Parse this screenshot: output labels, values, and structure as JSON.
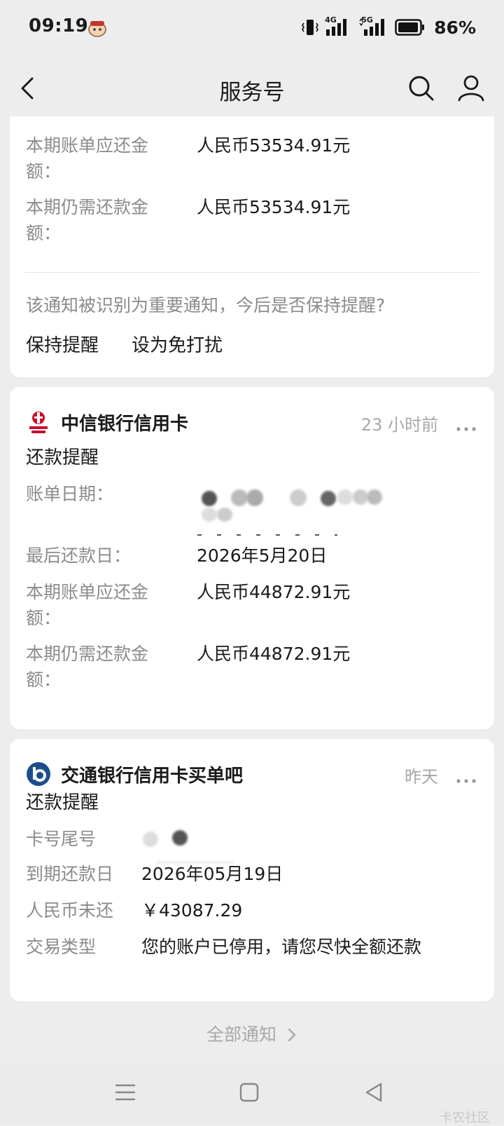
{
  "status_bar": {
    "time": "09:19",
    "network_1": "4G",
    "network_2": "5G",
    "battery": "86%",
    "icons": [
      "app-avatar-icon",
      "vibrate-icon",
      "signal-4g-icon",
      "signal-5g-icon",
      "battery-icon"
    ]
  },
  "header": {
    "title": "服务号",
    "icons": [
      "back-icon",
      "search-icon",
      "user-icon"
    ]
  },
  "card1": {
    "rows": [
      {
        "label_1": "本期账单应还金",
        "label_2": "额：",
        "value": "人民币53534.91元"
      },
      {
        "label_1": "本期仍需还款金",
        "label_2": "额：",
        "value": "人民币53534.91元"
      }
    ],
    "notice": "该通知被识别为重要通知，今后是否保持提醒?",
    "action_keep": "保持提醒",
    "action_mute": "设为免打扰"
  },
  "card2": {
    "sender": "中信银行信用卡",
    "time": "23 小时前",
    "subject": "还款提醒",
    "bill_date_label": "账单日期：",
    "rows": [
      {
        "label": "最后还款日：",
        "value": "2026年5月20日"
      },
      {
        "label_1": "本期账单应还金",
        "label_2": "额：",
        "value": "人民币44872.91元"
      },
      {
        "label_1": "本期仍需还款金",
        "label_2": "额：",
        "value": "人民币44872.91元"
      }
    ]
  },
  "card3": {
    "sender": "交通银行信用卡买单吧",
    "time": "昨天",
    "subject": "还款提醒",
    "card_tail_label": "卡号尾号",
    "rows": [
      {
        "label": "到期还款日",
        "value": "2026年05月19日"
      },
      {
        "label": "人民币未还",
        "value": "￥43087.29"
      },
      {
        "label": "交易类型",
        "value": "您的账户已停用，请您尽快全额还款"
      }
    ]
  },
  "footer": {
    "all_notices": "全部通知"
  },
  "nav": {
    "icons": [
      "menu-icon",
      "home-icon",
      "back-triangle-icon"
    ]
  },
  "watermark": "卡农社区",
  "colors": {
    "background": "#EDEDED",
    "card": "#FFFFFF",
    "label": "#8B8B8B",
    "text": "#1A1A1A",
    "citic_red": "#C8102E",
    "bocom_blue": "#1B4E8C"
  }
}
